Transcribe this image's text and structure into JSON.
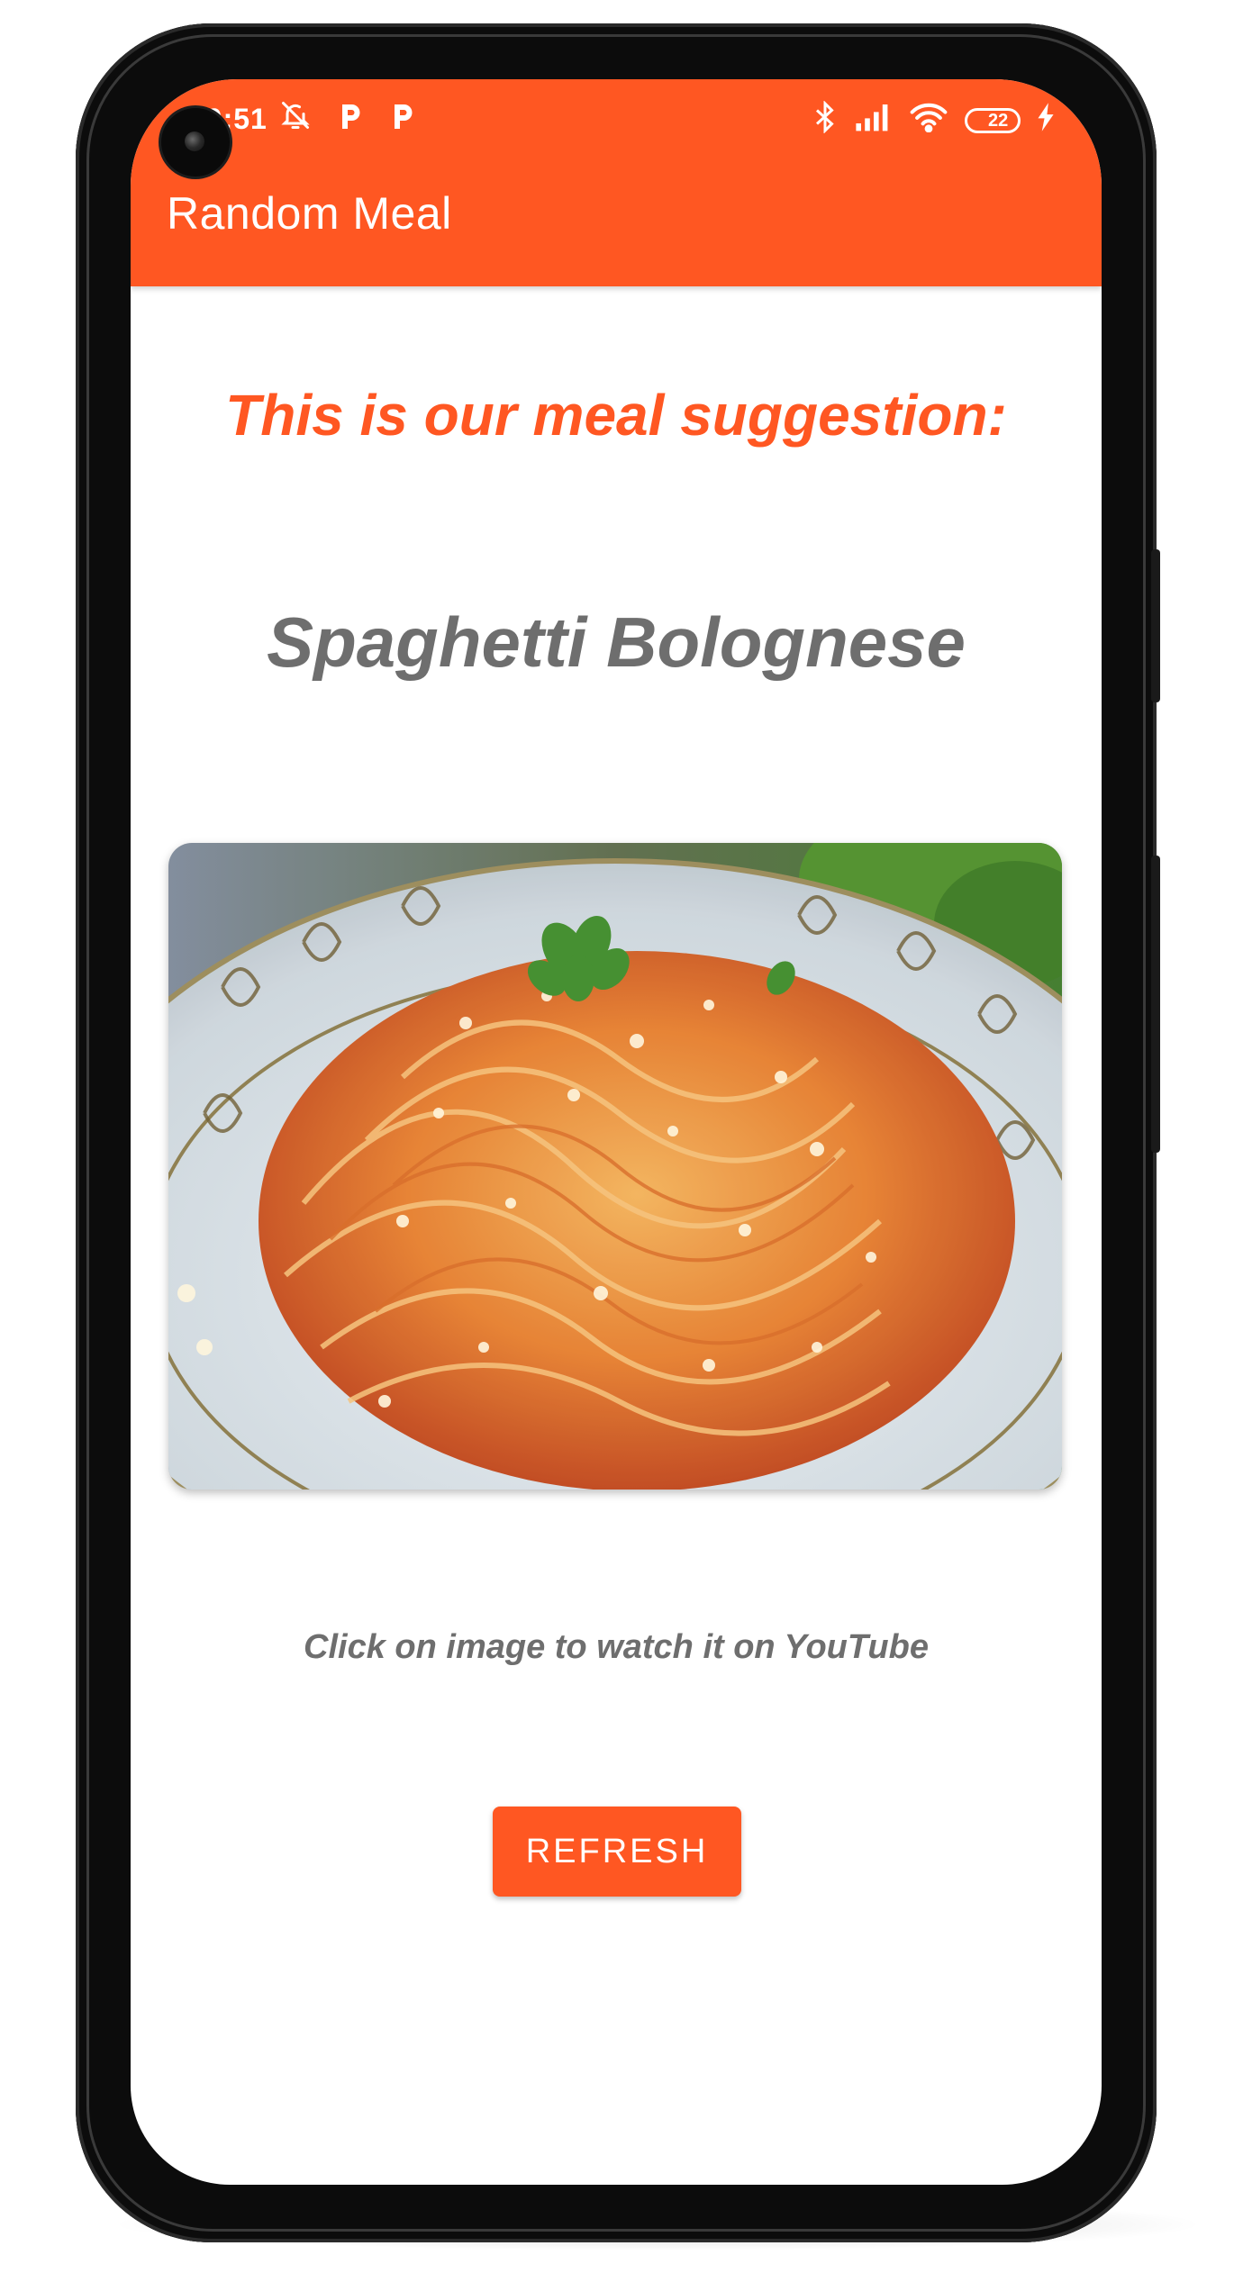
{
  "status_bar": {
    "time": "20:51",
    "battery_level": "22",
    "icons": [
      "camera-icon",
      "bell-off-icon",
      "p-notification-icon",
      "p-notification-icon",
      "bluetooth-icon",
      "cellular-signal-icon",
      "wifi-icon",
      "battery-icon",
      "charging-bolt-icon"
    ]
  },
  "app_bar": {
    "title": "Random Meal",
    "color": "#ff5722"
  },
  "content": {
    "heading": "This is our meal suggestion:",
    "meal_name": "Spaghetti Bolognese",
    "image_icon": "spaghetti-bolognese-photo",
    "hint": "Click on image to watch it on YouTube",
    "refresh_label": "REFRESH"
  },
  "colors": {
    "accent": "#ff5722",
    "secondary_text": "#6e6e6e"
  }
}
